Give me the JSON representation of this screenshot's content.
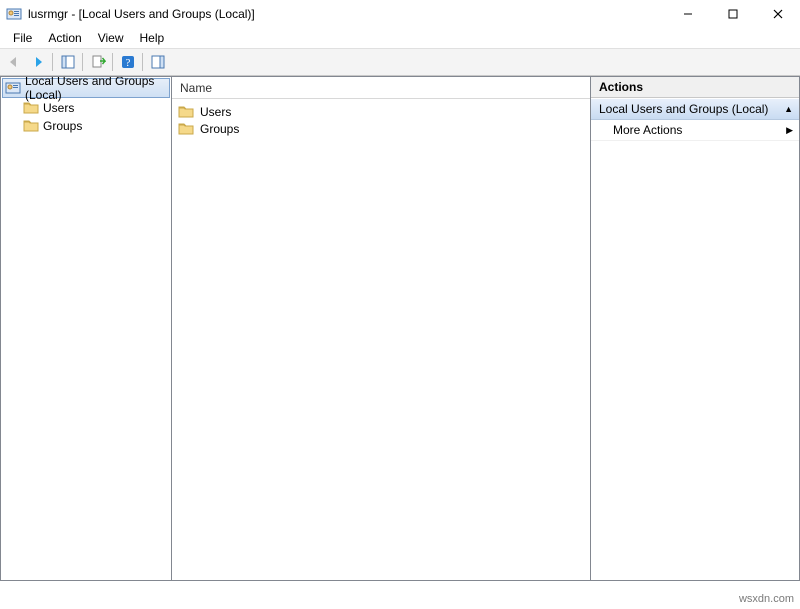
{
  "title": "lusrmgr - [Local Users and Groups (Local)]",
  "menubar": {
    "file": "File",
    "action": "Action",
    "view": "View",
    "help": "Help"
  },
  "tree": {
    "root": "Local Users and Groups (Local)",
    "children": [
      "Users",
      "Groups"
    ]
  },
  "list": {
    "column_name": "Name",
    "items": [
      "Users",
      "Groups"
    ]
  },
  "actions": {
    "header": "Actions",
    "group": "Local Users and Groups (Local)",
    "more": "More Actions"
  },
  "watermark": "wsxdn.com"
}
